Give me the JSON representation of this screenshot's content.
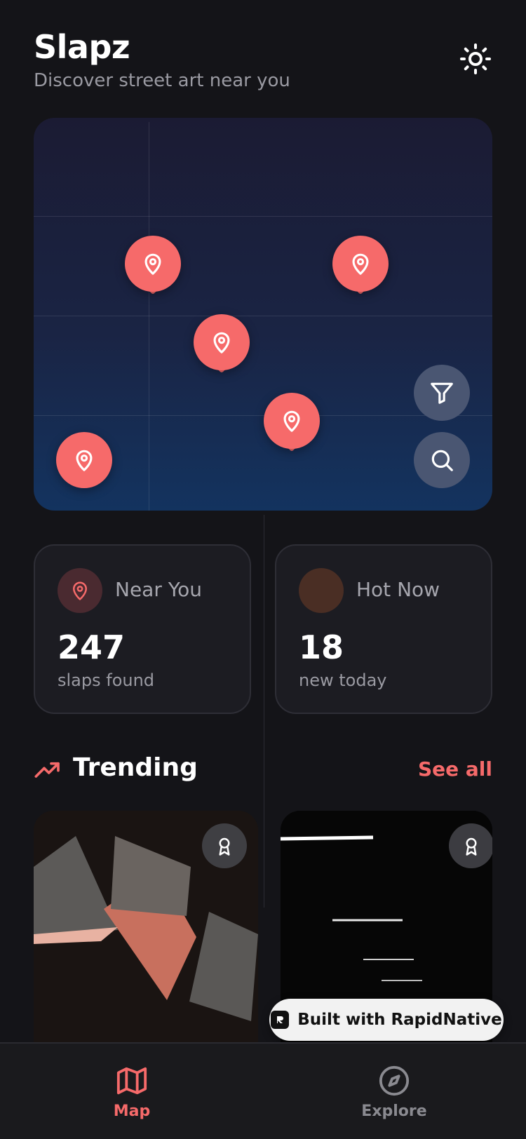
{
  "header": {
    "title": "Slapz",
    "subtitle": "Discover street art near you"
  },
  "map": {
    "pin_icon": "map-pin-icon",
    "actions": [
      "filter-icon",
      "search-icon"
    ]
  },
  "stats": [
    {
      "label": "Near You",
      "value": "247",
      "caption": "slaps found",
      "icon": "map-pin-icon",
      "icon_bg": "#4a2a30"
    },
    {
      "label": "Hot Now",
      "value": "18",
      "caption": "new today",
      "icon": "",
      "icon_bg": "#4a2e24"
    }
  ],
  "trending": {
    "title": "Trending",
    "see_all": "See all"
  },
  "built_with": "Built with RapidNative",
  "tabs": [
    {
      "label": "Map",
      "active": true
    },
    {
      "label": "Explore",
      "active": false
    }
  ],
  "colors": {
    "accent": "#f66a6a",
    "background": "#141418",
    "card": "#1c1c22",
    "inactive": "#8a8a90"
  }
}
